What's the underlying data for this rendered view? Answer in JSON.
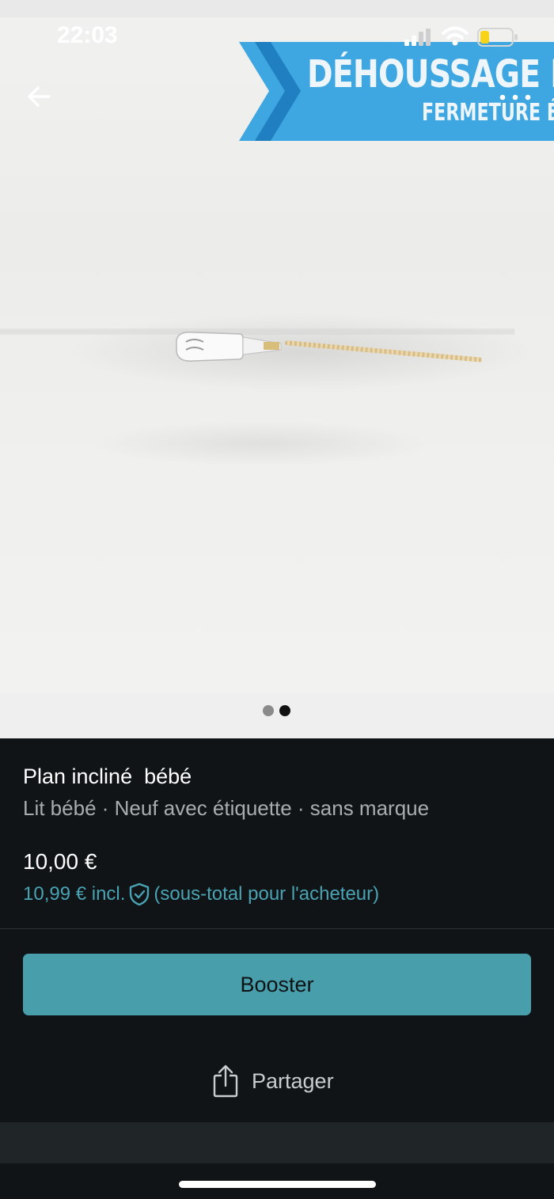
{
  "status_bar": {
    "time": "22:03"
  },
  "photo": {
    "banner_line1": "DÉHOUSSAGE FAC",
    "banner_line2": "FERMETURE ÉC",
    "banner_color": "#3ea6e0"
  },
  "gallery": {
    "total_images": 2,
    "current_index": 2
  },
  "product": {
    "title": "Plan incliné  bébé",
    "details": "Lit bébé · Neuf avec étiquette · sans marque",
    "price": "10,00 €",
    "buyer_price": "10,99 € incl.",
    "buyer_note": "(sous-total pour l'acheteur)"
  },
  "actions": {
    "booster_label": "Booster",
    "share_label": "Partager"
  },
  "colors": {
    "accent": "#489fab",
    "link": "#4aa3b3",
    "background": "#101416"
  },
  "icons": {
    "back": "arrow-left-icon",
    "more": "more-horizontal-icon",
    "shield": "shield-check-icon",
    "share": "share-icon"
  }
}
